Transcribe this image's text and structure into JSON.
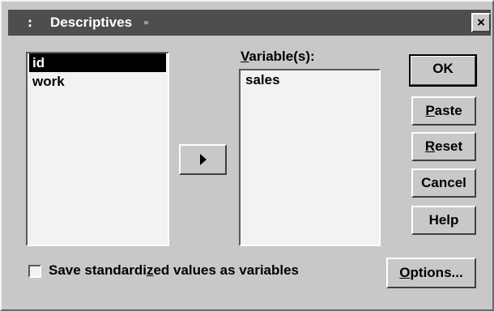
{
  "window": {
    "title": "Descriptives",
    "sysmenu_glyph": ":",
    "close_glyph": "×"
  },
  "source_list": {
    "items": [
      "id",
      "work"
    ],
    "selected_index": 0
  },
  "variables": {
    "label_underlined": "V",
    "label_rest": "ariable(s):",
    "items": [
      "sales"
    ]
  },
  "buttons": {
    "ok": "OK",
    "paste_u": "P",
    "paste_rest": "aste",
    "reset_u": "R",
    "reset_rest": "eset",
    "cancel": "Cancel",
    "help": "Help",
    "options_u": "O",
    "options_rest": "ptions..."
  },
  "checkbox": {
    "label_pre": "Save standardi",
    "label_u": "z",
    "label_post": "ed values as variables",
    "checked": false
  },
  "icons": {
    "transfer": "right-triangle-arrow-icon",
    "close": "close-x-icon",
    "sysmenu": "system-menu-icon"
  },
  "colors": {
    "titlebar": "#4e4e4e",
    "dialog": "#c8c8c8",
    "list_bg": "#f2f2f2",
    "selection": "#000000"
  }
}
